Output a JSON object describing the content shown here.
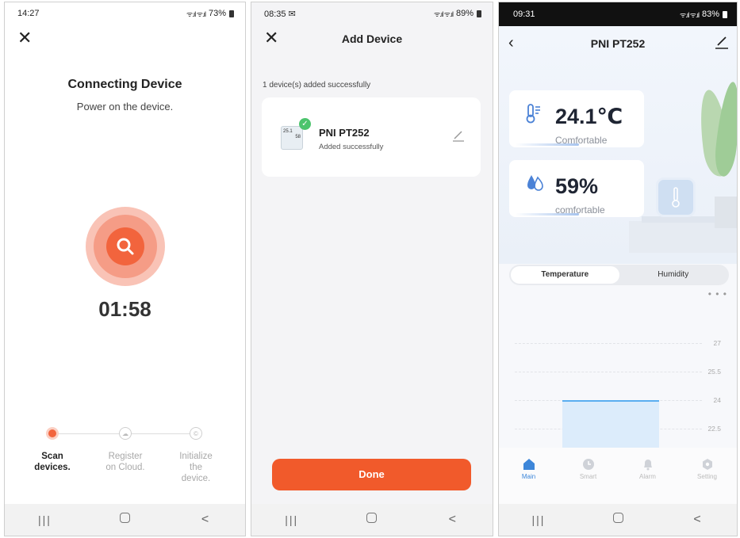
{
  "panel1": {
    "status": {
      "time": "14:27",
      "battery": "73%"
    },
    "title": "Connecting Device",
    "subtitle": "Power on the device.",
    "timer": "01:58",
    "steps": [
      {
        "label": "Scan devices.",
        "state": "active"
      },
      {
        "label": "Register on Cloud.",
        "state": "idle"
      },
      {
        "label": "Initialize the device.",
        "state": "idle"
      }
    ],
    "close_icon": "close-icon",
    "search_icon": "search-icon"
  },
  "panel2": {
    "status": {
      "time": "08:35",
      "battery": "89%"
    },
    "title": "Add Device",
    "message": "1 device(s) added successfully",
    "device": {
      "name": "PNI PT252",
      "status": "Added successfully",
      "screen_top": "25.1",
      "screen_bottom": "58"
    },
    "done_label": "Done",
    "colors": {
      "accent": "#f15a2b",
      "success": "#4cc46d"
    }
  },
  "panel3": {
    "status": {
      "time": "09:31",
      "battery": "83%"
    },
    "title": "PNI PT252",
    "temperature": {
      "value": "24.1℃",
      "label": "Comfortable"
    },
    "humidity": {
      "value": "59%",
      "label": "comfortable"
    },
    "tabs": [
      "Temperature",
      "Humidity"
    ],
    "active_tab": "Temperature",
    "more": "• • •",
    "chart_data": {
      "type": "bar",
      "categories": [
        ""
      ],
      "values": [
        24
      ],
      "y_ticks": [
        "27",
        "25.5",
        "24",
        "22.5"
      ],
      "ylim": [
        22,
        27.5
      ],
      "title": "",
      "xlabel": "",
      "ylabel": ""
    },
    "bottom_tabs": [
      {
        "label": "Main",
        "icon": "home-icon",
        "active": true
      },
      {
        "label": "Smart",
        "icon": "clock-icon",
        "active": false
      },
      {
        "label": "Alarm",
        "icon": "bell-icon",
        "active": false
      },
      {
        "label": "Setting",
        "icon": "hexagon-icon",
        "active": false
      }
    ],
    "colors": {
      "accent": "#3d86d9",
      "bar": "#dcecfb",
      "bar_line": "#5aaef0"
    }
  },
  "nav": {
    "recent": "|||",
    "home": "home",
    "back": "<"
  }
}
